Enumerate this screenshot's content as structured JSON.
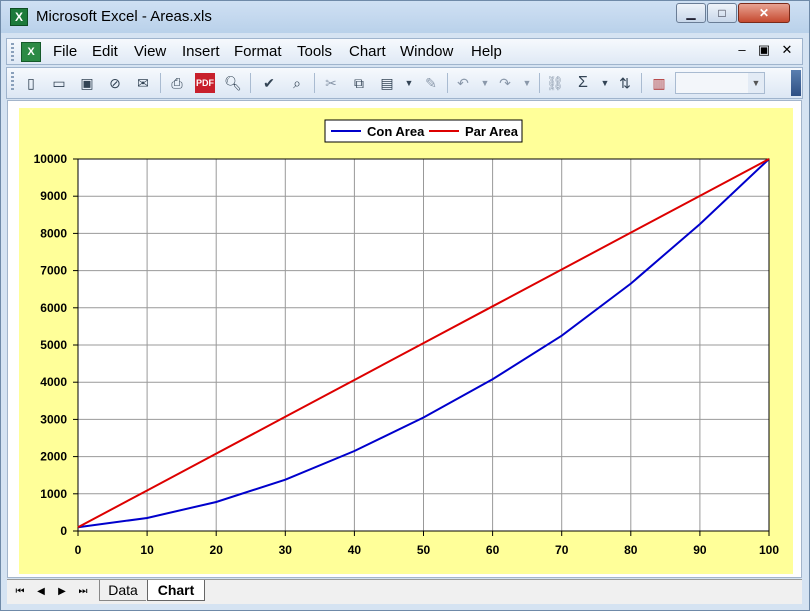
{
  "window": {
    "title": "Microsoft Excel - Areas.xls",
    "controls": {
      "minimize": "▁",
      "maximize": "□",
      "close": "✕"
    }
  },
  "menu": {
    "items": [
      "File",
      "Edit",
      "View",
      "Insert",
      "Format",
      "Tools",
      "Chart",
      "Window",
      "Help"
    ],
    "doc_controls": {
      "minimize": "‒",
      "restore": "▣",
      "close": "✕"
    }
  },
  "toolbar": {
    "icons": [
      "new-icon",
      "open-icon",
      "save-icon",
      "permission-icon",
      "email-icon",
      "print-icon",
      "pdf-icon",
      "print-preview-icon",
      "spelling-icon",
      "research-icon",
      "cut-icon",
      "copy-icon",
      "paste-icon",
      "format-painter-icon",
      "undo-icon",
      "redo-icon",
      "hyperlink-icon",
      "autosum-icon",
      "sort-icon",
      "chart-wizard-icon"
    ],
    "zoom_value": ""
  },
  "chart_data": {
    "type": "line",
    "legend": {
      "position": "top-center",
      "entries": [
        "Con Area",
        "Par Area"
      ]
    },
    "x": [
      0,
      10,
      20,
      30,
      40,
      50,
      60,
      70,
      80,
      90,
      100
    ],
    "series": [
      {
        "name": "Con Area",
        "color": "#0000cc",
        "values": [
          100,
          350,
          780,
          1380,
          2150,
          3050,
          4080,
          5250,
          6650,
          8250,
          10000
        ]
      },
      {
        "name": "Par Area",
        "color": "#dd0000",
        "values": [
          100,
          1090,
          2080,
          3070,
          4060,
          5050,
          6040,
          7030,
          8020,
          9010,
          10000
        ]
      }
    ],
    "xlim": [
      0,
      100
    ],
    "ylim": [
      0,
      10000
    ],
    "xticks": [
      0,
      10,
      20,
      30,
      40,
      50,
      60,
      70,
      80,
      90,
      100
    ],
    "yticks": [
      0,
      1000,
      2000,
      3000,
      4000,
      5000,
      6000,
      7000,
      8000,
      9000,
      10000
    ],
    "grid": true,
    "plot_background": "#ffffff",
    "chart_background": "#ffff99"
  },
  "sheets": {
    "nav": [
      "⏮",
      "◀",
      "▶",
      "⏭"
    ],
    "tabs": [
      "Data",
      "Chart"
    ],
    "active": "Chart"
  }
}
